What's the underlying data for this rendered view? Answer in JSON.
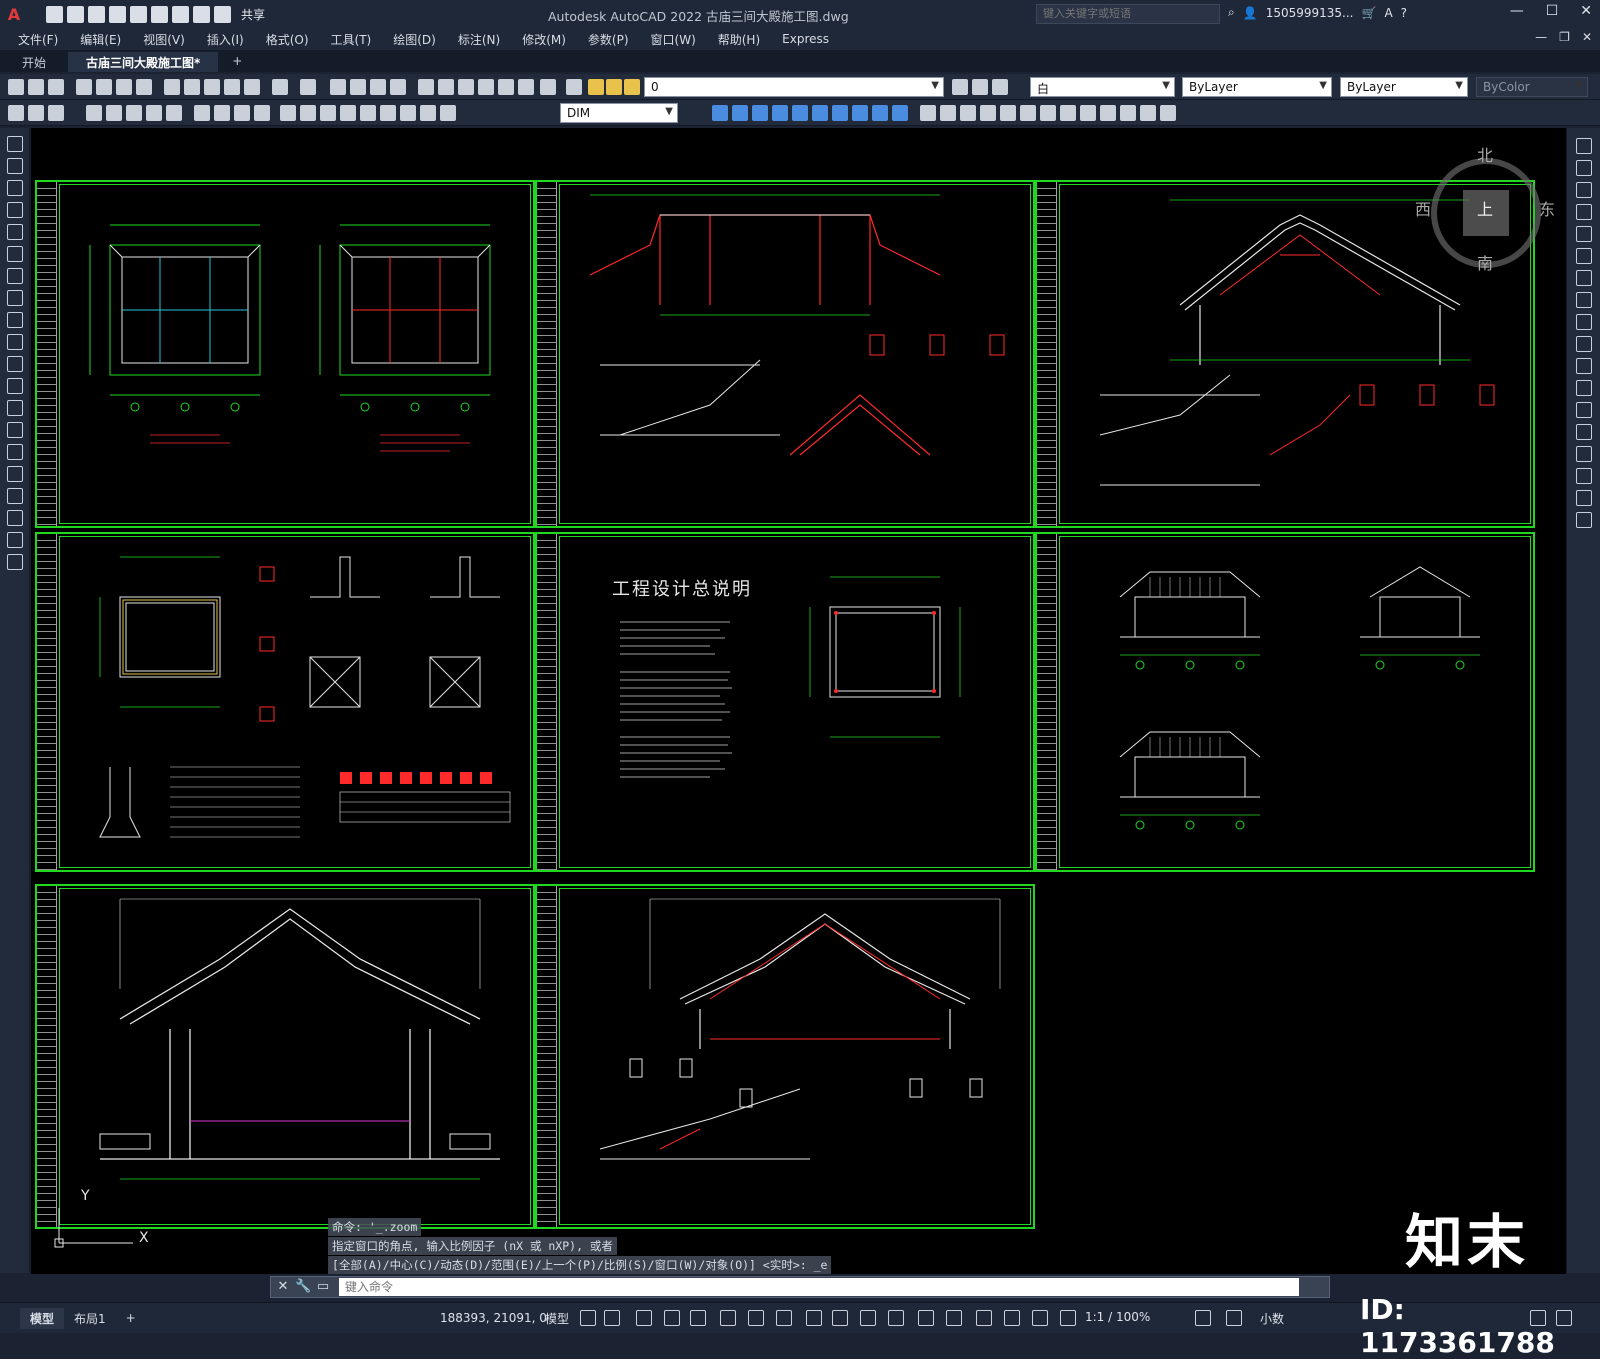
{
  "app": {
    "title": "Autodesk AutoCAD 2022    古庙三间大殿施工图.dwg",
    "share_label": "共享",
    "search_placeholder": "键入关键字或短语",
    "user": "1505999135...",
    "logo": "A"
  },
  "menu": [
    "文件(F)",
    "编辑(E)",
    "视图(V)",
    "插入(I)",
    "格式(O)",
    "工具(T)",
    "绘图(D)",
    "标注(N)",
    "修改(M)",
    "参数(P)",
    "窗口(W)",
    "帮助(H)",
    "Express"
  ],
  "tabs": [
    {
      "label": "开始",
      "active": false
    },
    {
      "label": "古庙三间大殿施工图*",
      "active": true
    },
    {
      "label": "+",
      "active": false
    }
  ],
  "toolbar": {
    "layer_value": "0",
    "color_value": "白",
    "linetype_value": "ByLayer",
    "lineweight_value": "ByLayer",
    "plotstyle_value": "ByColor",
    "dimstyle_value": "DIM"
  },
  "drawing": {
    "design_title": "工程设计总说明",
    "viewcube": {
      "north": "北",
      "south": "南",
      "east": "东",
      "west": "西",
      "face": "上"
    },
    "ucs_x": "X",
    "ucs_y": "Y"
  },
  "command": {
    "history": [
      "命令: '_.zoom",
      "指定窗口的角点, 输入比例因子 (nX 或 nXP), 或者",
      "[全部(A)/中心(C)/动态(D)/范围(E)/上一个(P)/比例(S)/窗口(W)/对象(O)] <实时>: _e"
    ],
    "placeholder": "键入命令"
  },
  "status": {
    "tabs": [
      {
        "label": "模型",
        "active": true
      },
      {
        "label": "布局1",
        "active": false
      },
      {
        "label": "+",
        "active": false
      }
    ],
    "coords": "188393, 21091, 0",
    "mode": "模型",
    "scale": "1:1 / 100%",
    "units": "小数"
  },
  "watermark": {
    "logo": "知末",
    "id": "ID: 1173361788"
  }
}
